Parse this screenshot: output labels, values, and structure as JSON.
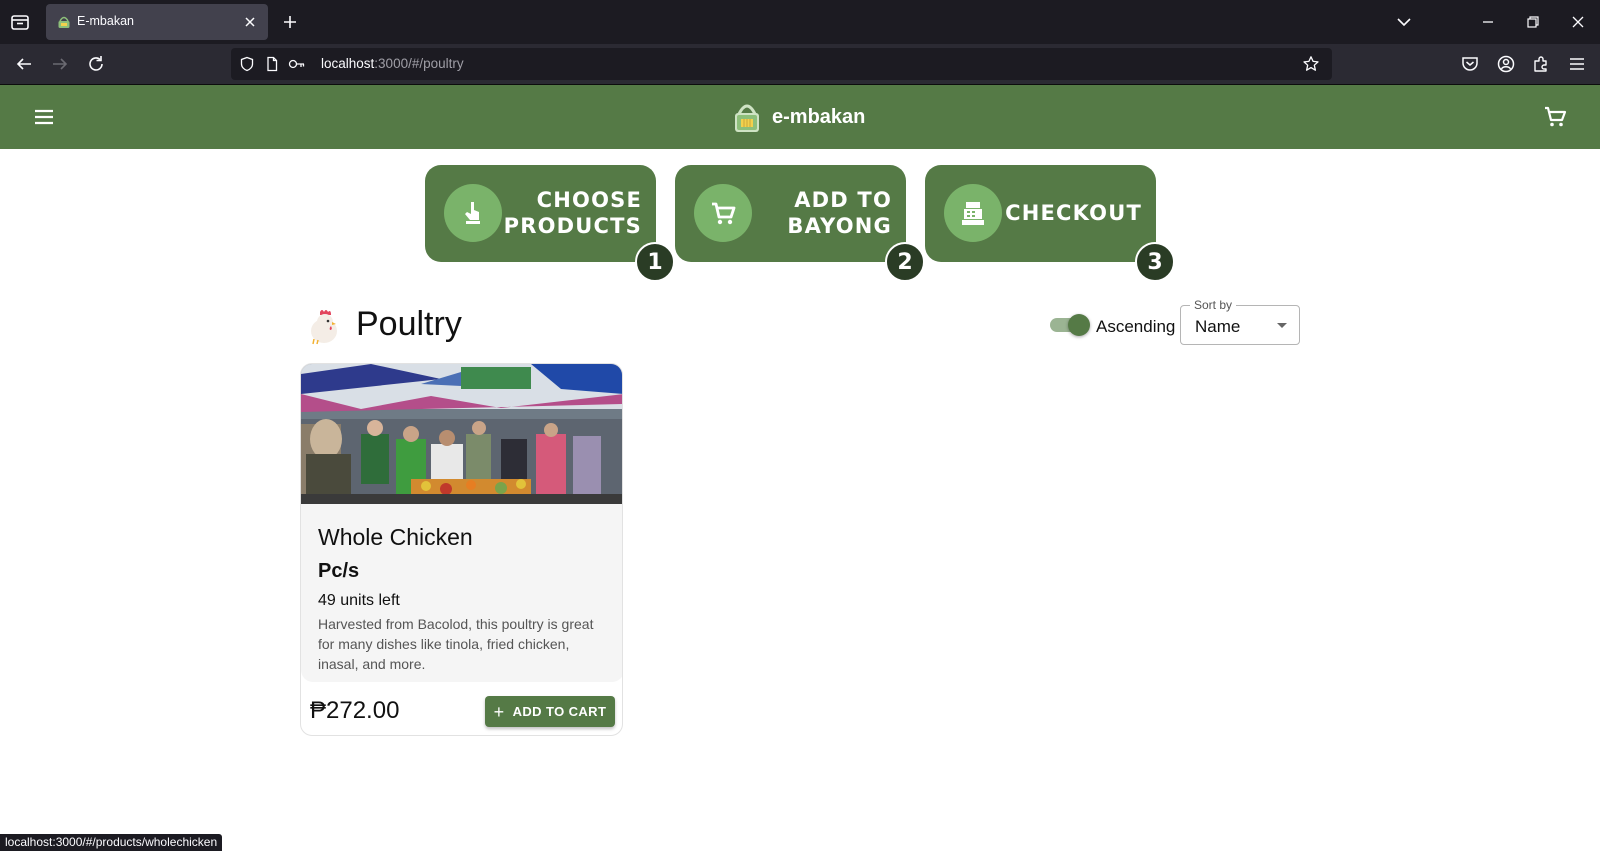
{
  "browser": {
    "tab_title": "E-mbakan",
    "url_host": "localhost",
    "url_rest": ":3000/#/poultry",
    "status_url": "localhost:3000/#/products/wholechicken"
  },
  "header": {
    "brand": "e-mbakan",
    "accent": "#557a46"
  },
  "steps": [
    {
      "label_line1": "CHOOSE",
      "label_line2": "PRODUCTS",
      "number": "1",
      "icon": "hand-point-icon"
    },
    {
      "label_line1": "ADD TO",
      "label_line2": "BAYONG",
      "number": "2",
      "icon": "cart-icon"
    },
    {
      "label_line1": "CHECKOUT",
      "label_line2": "",
      "number": "3",
      "icon": "cash-register-icon"
    }
  ],
  "category": {
    "title": "Poultry",
    "icon": "chicken-icon",
    "sort_toggle_label": "Ascending",
    "sort_toggle_on": true,
    "sort_by_legend": "Sort by",
    "sort_by_value": "Name"
  },
  "products": [
    {
      "name": "Whole Chicken",
      "unit": "Pc/s",
      "stock": "49 units left",
      "description": "Harvested from Bacolod, this poultry is great for many dishes like tinola, fried chicken, inasal, and more.",
      "price": "₱272.00",
      "add_label": "ADD TO CART"
    }
  ]
}
